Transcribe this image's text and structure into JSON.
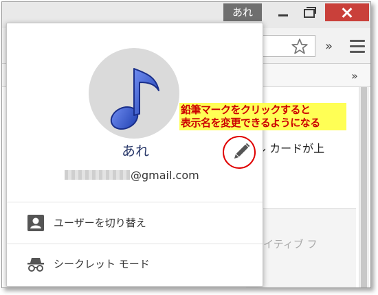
{
  "window": {
    "profile_chip": "あれ"
  },
  "popup": {
    "profile_name": "あれ",
    "email_suffix": "@gmail.com",
    "menu": {
      "switch_user": "ユーザーを切り替え",
      "incognito": "シークレット モード"
    }
  },
  "page": {
    "text_line1": "ル カードが上",
    "text_line2": "イティブ フ"
  },
  "annotation": {
    "line1": "鉛筆マークをクリックすると",
    "line2": "表示名を変更できるようになる"
  },
  "colors": {
    "close_button": "#c9403a",
    "annotation_background": "#ffff55",
    "annotation_text": "#cc0000",
    "note_icon": "#3a5fd6",
    "avatar_background": "#dadada"
  },
  "icons": {
    "avatar": "music-note-icon",
    "edit": "pencil-icon",
    "switch_user": "person-badge-icon",
    "incognito": "incognito-icon",
    "bookmark": "star-icon",
    "menu": "hamburger-menu-icon"
  }
}
